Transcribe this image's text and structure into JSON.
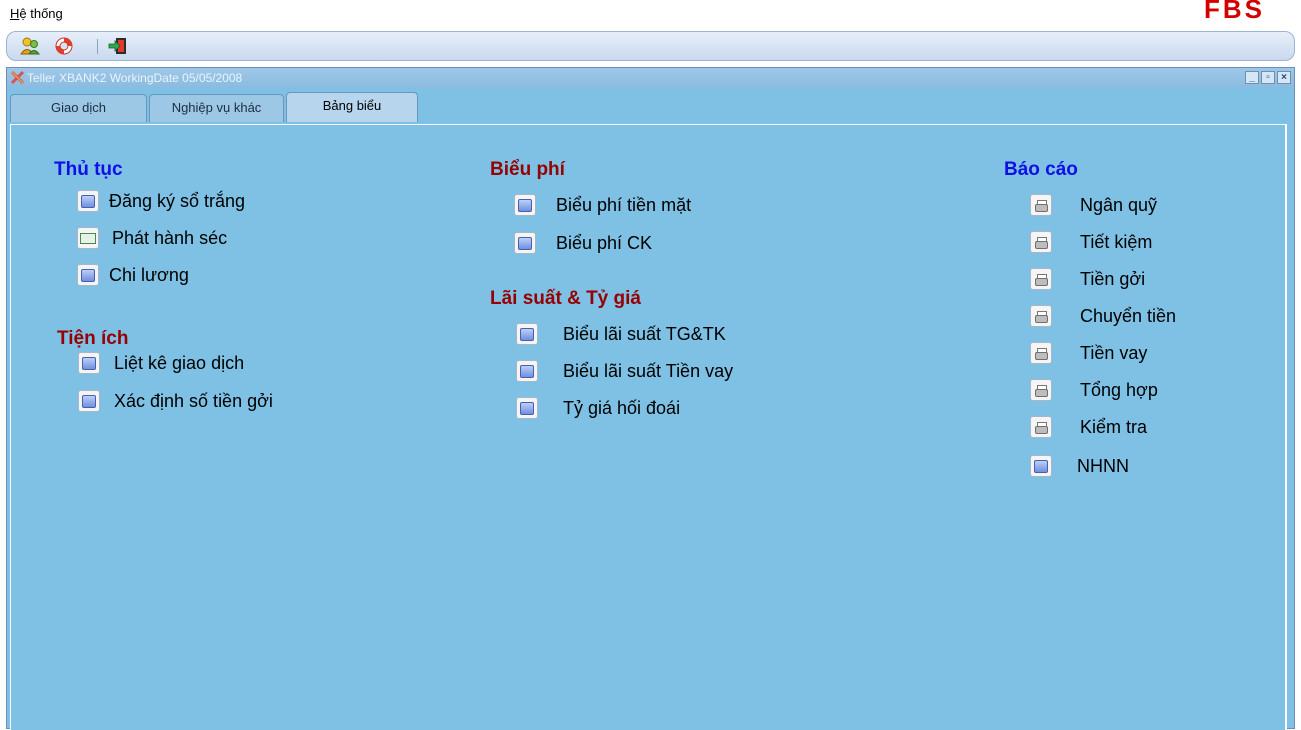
{
  "menu": {
    "system_label": "Hệ thống",
    "system_hotkey": "H",
    "system_rest": "ệ thống"
  },
  "brand": "FBS",
  "toolbar": {
    "icons": [
      "users-icon",
      "lifebuoy-icon",
      "exit-icon"
    ]
  },
  "window": {
    "title": "Teller XBANK2 WorkingDate 05/05/2008",
    "controls": [
      "minimize-icon",
      "restore-icon",
      "close-icon"
    ]
  },
  "tabs": [
    {
      "label": "Giao dịch",
      "active": false
    },
    {
      "label": "Nghiệp vụ khác",
      "active": false
    },
    {
      "label": "Bảng biểu",
      "active": true
    }
  ],
  "sections": {
    "thu_tuc": {
      "title": "Thủ tục",
      "items": [
        "Đăng ký sổ trắng",
        "Phát hành séc",
        "Chi lương"
      ]
    },
    "tien_ich": {
      "title": "Tiện ích",
      "items": [
        "Liệt kê giao dịch",
        "Xác định số tiền gởi"
      ]
    },
    "bieu_phi": {
      "title": "Biểu phí",
      "items": [
        "Biểu phí tiền mặt",
        "Biểu phí CK"
      ]
    },
    "lai_suat": {
      "title": "Lãi suất & Tỷ giá",
      "items": [
        "Biểu lãi suất TG&TK",
        "Biểu lãi suất Tiền vay",
        "Tỷ giá hối đoái"
      ]
    },
    "bao_cao": {
      "title": "Báo cáo",
      "items": [
        "Ngân quỹ",
        "Tiết kiệm",
        "Tiền gởi",
        "Chuyển tiền",
        "Tiền vay",
        "Tổng hợp",
        "Kiểm tra",
        "NHNN"
      ]
    }
  },
  "colors": {
    "panel_bg": "#7fc1e4",
    "title_blue": "#1010e6",
    "title_red": "#960000",
    "brand_red": "#d40000"
  }
}
